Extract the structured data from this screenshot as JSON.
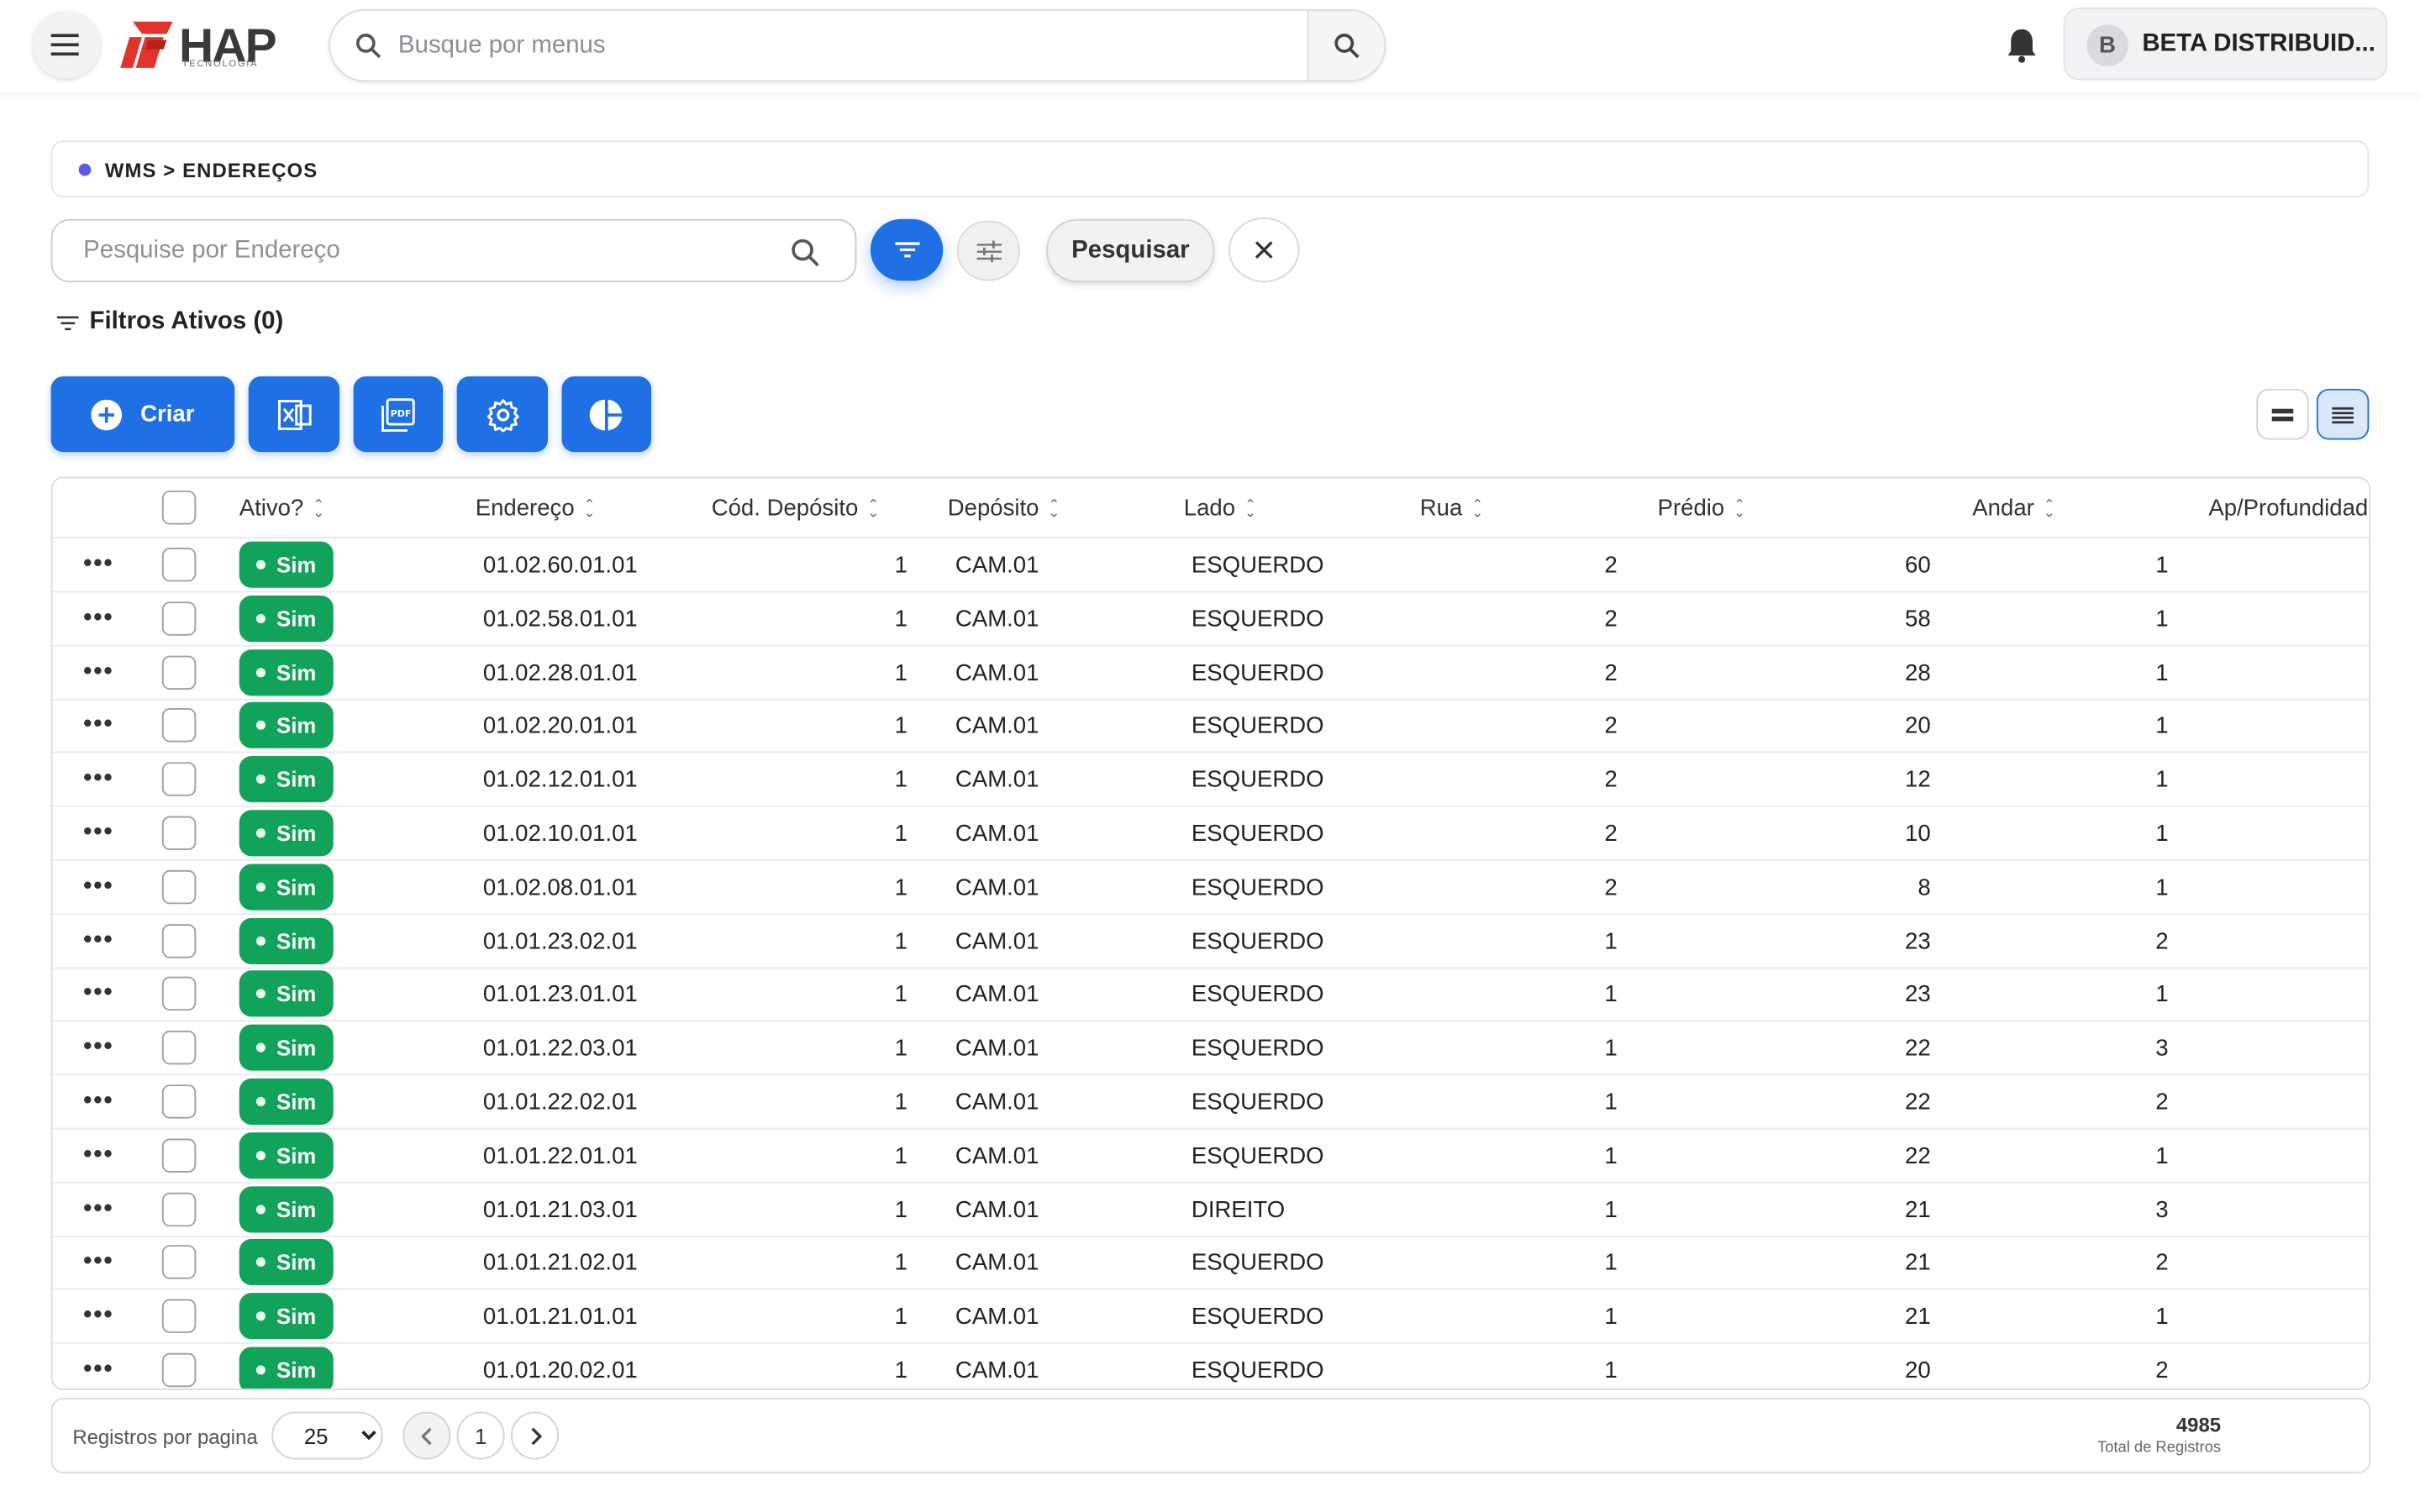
{
  "header": {
    "logo_text": "HAP",
    "logo_sub": "TECNOLOGIA",
    "search_placeholder": "Busque por menus",
    "user_initial": "B",
    "user_name": "BETA DISTRIBUID..."
  },
  "breadcrumb": "WMS > ENDEREÇOS",
  "toolbar": {
    "search_placeholder": "Pesquise por Endereço",
    "search_button": "Pesquisar",
    "active_filters": "Filtros Ativos (0)",
    "create_label": "Criar"
  },
  "colors": {
    "primary": "#1f6fe5",
    "success": "#12a35b",
    "logo_red": "#e2332a"
  },
  "table": {
    "columns": [
      "Ativo?",
      "Endereço",
      "Cód. Depósito",
      "Depósito",
      "Lado",
      "Rua",
      "Prédio",
      "Andar",
      "Ap/Profundidad"
    ],
    "rows": [
      {
        "ativo": "Sim",
        "endereco": "01.02.60.01.01",
        "cod": "1",
        "deposito": "CAM.01",
        "lado": "ESQUERDO",
        "rua": "2",
        "predio": "60",
        "andar": "1"
      },
      {
        "ativo": "Sim",
        "endereco": "01.02.58.01.01",
        "cod": "1",
        "deposito": "CAM.01",
        "lado": "ESQUERDO",
        "rua": "2",
        "predio": "58",
        "andar": "1"
      },
      {
        "ativo": "Sim",
        "endereco": "01.02.28.01.01",
        "cod": "1",
        "deposito": "CAM.01",
        "lado": "ESQUERDO",
        "rua": "2",
        "predio": "28",
        "andar": "1"
      },
      {
        "ativo": "Sim",
        "endereco": "01.02.20.01.01",
        "cod": "1",
        "deposito": "CAM.01",
        "lado": "ESQUERDO",
        "rua": "2",
        "predio": "20",
        "andar": "1"
      },
      {
        "ativo": "Sim",
        "endereco": "01.02.12.01.01",
        "cod": "1",
        "deposito": "CAM.01",
        "lado": "ESQUERDO",
        "rua": "2",
        "predio": "12",
        "andar": "1"
      },
      {
        "ativo": "Sim",
        "endereco": "01.02.10.01.01",
        "cod": "1",
        "deposito": "CAM.01",
        "lado": "ESQUERDO",
        "rua": "2",
        "predio": "10",
        "andar": "1"
      },
      {
        "ativo": "Sim",
        "endereco": "01.02.08.01.01",
        "cod": "1",
        "deposito": "CAM.01",
        "lado": "ESQUERDO",
        "rua": "2",
        "predio": "8",
        "andar": "1"
      },
      {
        "ativo": "Sim",
        "endereco": "01.01.23.02.01",
        "cod": "1",
        "deposito": "CAM.01",
        "lado": "ESQUERDO",
        "rua": "1",
        "predio": "23",
        "andar": "2"
      },
      {
        "ativo": "Sim",
        "endereco": "01.01.23.01.01",
        "cod": "1",
        "deposito": "CAM.01",
        "lado": "ESQUERDO",
        "rua": "1",
        "predio": "23",
        "andar": "1"
      },
      {
        "ativo": "Sim",
        "endereco": "01.01.22.03.01",
        "cod": "1",
        "deposito": "CAM.01",
        "lado": "ESQUERDO",
        "rua": "1",
        "predio": "22",
        "andar": "3"
      },
      {
        "ativo": "Sim",
        "endereco": "01.01.22.02.01",
        "cod": "1",
        "deposito": "CAM.01",
        "lado": "ESQUERDO",
        "rua": "1",
        "predio": "22",
        "andar": "2"
      },
      {
        "ativo": "Sim",
        "endereco": "01.01.22.01.01",
        "cod": "1",
        "deposito": "CAM.01",
        "lado": "ESQUERDO",
        "rua": "1",
        "predio": "22",
        "andar": "1"
      },
      {
        "ativo": "Sim",
        "endereco": "01.01.21.03.01",
        "cod": "1",
        "deposito": "CAM.01",
        "lado": "DIREITO",
        "rua": "1",
        "predio": "21",
        "andar": "3"
      },
      {
        "ativo": "Sim",
        "endereco": "01.01.21.02.01",
        "cod": "1",
        "deposito": "CAM.01",
        "lado": "ESQUERDO",
        "rua": "1",
        "predio": "21",
        "andar": "2"
      },
      {
        "ativo": "Sim",
        "endereco": "01.01.21.01.01",
        "cod": "1",
        "deposito": "CAM.01",
        "lado": "ESQUERDO",
        "rua": "1",
        "predio": "21",
        "andar": "1"
      },
      {
        "ativo": "Sim",
        "endereco": "01.01.20.02.01",
        "cod": "1",
        "deposito": "CAM.01",
        "lado": "ESQUERDO",
        "rua": "1",
        "predio": "20",
        "andar": "2"
      }
    ]
  },
  "pagination": {
    "per_page_label": "Registros por pagina",
    "per_page_value": "25",
    "page": "1",
    "total": "4985",
    "total_label": "Total de Registros"
  }
}
